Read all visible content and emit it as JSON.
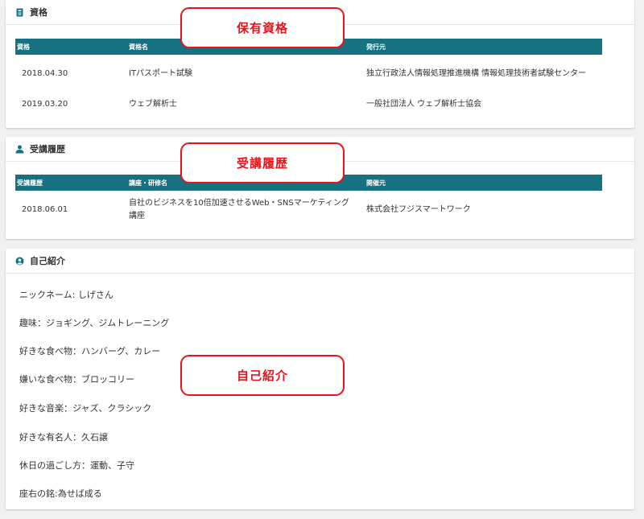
{
  "qualifications": {
    "title": "資格",
    "icon": "id-card-icon",
    "headers": [
      "資格",
      "資格名",
      "発行元"
    ],
    "rows": [
      [
        "2018.04.30",
        "ITパスポート試験",
        "独立行政法人情報処理推進機構 情報処理技術者試験センター"
      ],
      [
        "2019.03.20",
        "ウェブ解析士",
        "一般社団法人 ウェブ解析士協会"
      ]
    ]
  },
  "courses": {
    "title": "受講履歴",
    "icon": "teacher-icon",
    "headers": [
      "受講履歴",
      "講座・研修名",
      "開催元"
    ],
    "rows": [
      [
        "2018.06.01",
        "自社のビジネスを10倍加速させるWeb・SNSマーケティング講座",
        "株式会社フジスマートワーク"
      ]
    ]
  },
  "intro": {
    "title": "自己紹介",
    "icon": "user-circle-icon",
    "lines": [
      "ニックネーム: しげさん",
      "趣味：ジョギング、ジムトレーニング",
      "好きな食べ物：ハンバーグ、カレー",
      "嫌いな食べ物：ブロッコリー",
      "好きな音楽：ジャズ、クラシック",
      "好きな有名人：久石譲",
      "休日の過ごし方：運動、子守",
      "座右の銘:為せば成る"
    ]
  },
  "callouts": {
    "qualifications": "保有資格",
    "courses": "受講履歴",
    "intro": "自己紹介"
  },
  "colors": {
    "table_header": "#167181",
    "callout": "#e8141a"
  }
}
